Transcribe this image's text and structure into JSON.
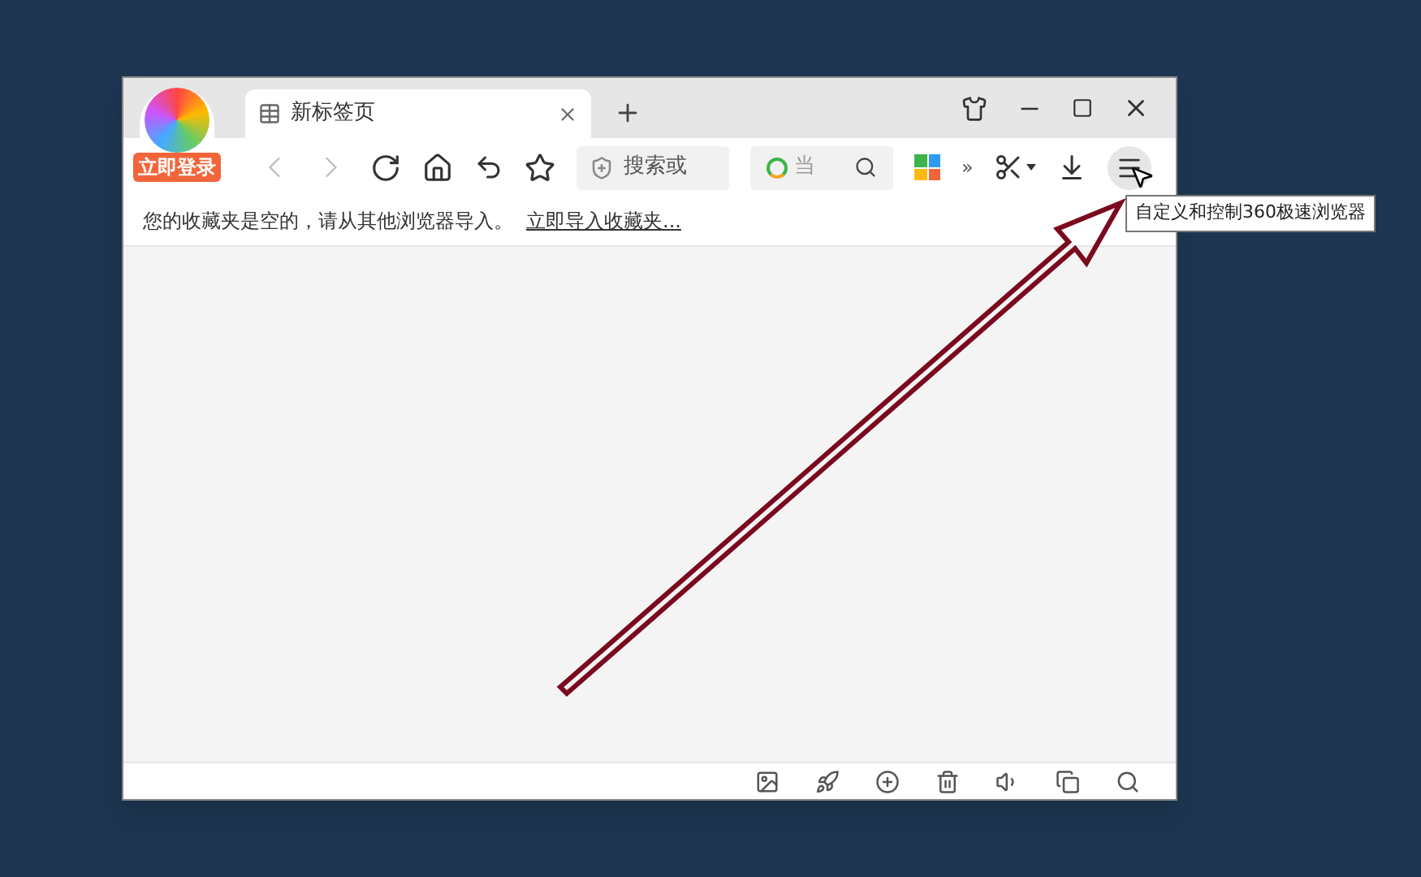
{
  "browser": {
    "login_badge": "立即登录",
    "tabs": [
      {
        "label": "新标签页",
        "selected": true
      }
    ],
    "nav": {
      "back_disabled": true,
      "forward_disabled": true
    },
    "address_field": {
      "placeholder": "搜索或"
    },
    "search_field": {
      "placeholder": "当"
    },
    "more_label": "»",
    "bookmarks_bar": {
      "message": "您的收藏夹是空的，请从其他浏览器导入。",
      "link": "立即导入收藏夹..."
    },
    "menu_tooltip": "自定义和控制360极速浏览器"
  }
}
